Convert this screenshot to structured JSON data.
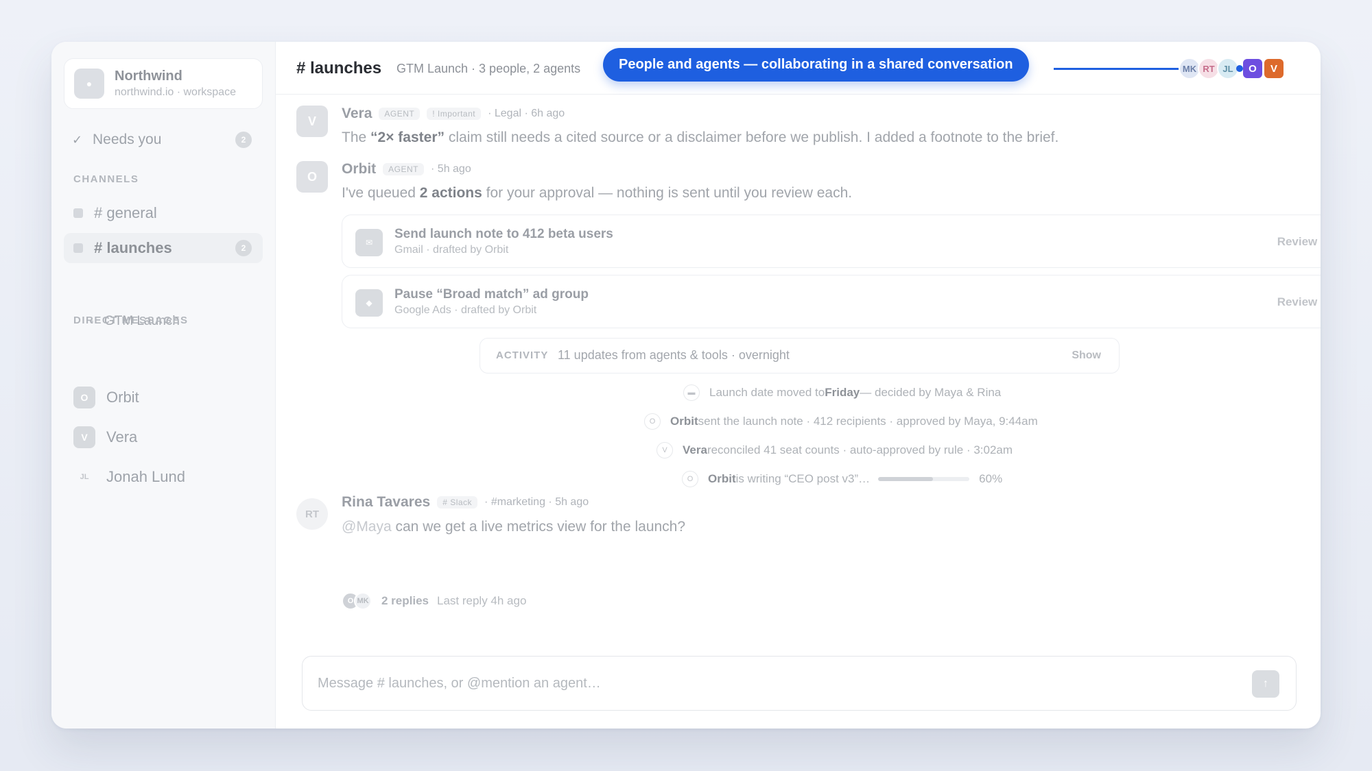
{
  "workspace": {
    "name": "Northwind",
    "subtitle": "northwind.io · workspace",
    "logo_icon": "circle-dot-icon"
  },
  "sidebar": {
    "needs_you": {
      "label": "Needs you",
      "count": "2",
      "icon": "check-icon"
    },
    "channels_heading": "CHANNELS",
    "channels": [
      {
        "label": "# general",
        "active": false,
        "count": ""
      },
      {
        "label": "# launches",
        "active": true,
        "count": "2"
      }
    ],
    "subchannel": "GTM Launch",
    "dm_heading": "DIRECT MESSAGES",
    "dms": [
      {
        "initials": "O",
        "label": "Orbit"
      },
      {
        "initials": "V",
        "label": "Vera"
      },
      {
        "initials": "JL",
        "label": "Jonah Lund"
      }
    ]
  },
  "header": {
    "channel": "# launches",
    "meta": "GTM Launch · 3 people, 2 agents",
    "callout": "People and agents — collaborating in a shared conversation",
    "participants": [
      {
        "initials": "MK",
        "color": "#dfe6f4",
        "text": "#6b7fa8"
      },
      {
        "initials": "RT",
        "color": "#f6dfe6",
        "text": "#c56c8a"
      },
      {
        "initials": "JL",
        "color": "#d8ebf3",
        "text": "#5e8fa6"
      },
      {
        "initials": "O",
        "color": "#6d4ee0",
        "text": "#ffffff"
      },
      {
        "initials": "V",
        "color": "#dd6a2c",
        "text": "#ffffff"
      }
    ],
    "accent": "#1e5fe0"
  },
  "messages": {
    "vera": {
      "avatar": "V",
      "name": "Vera",
      "tag1": "AGENT",
      "tag2": "! Important",
      "meta": "· Legal · 6h ago",
      "body_pre": "The ",
      "body_bold": "“2× faster”",
      "body_post": " claim still needs a cited source or a disclaimer before we publish. I added a footnote to the brief."
    },
    "orbit": {
      "avatar": "O",
      "name": "Orbit",
      "tag1": "AGENT",
      "meta": "· 5h ago",
      "body_pre": "I've queued ",
      "body_bold": "2 actions",
      "body_post": " for your approval — nothing is sent until you review each."
    },
    "rina": {
      "avatar": "RT",
      "name": "Rina Tavares",
      "tag1": "# Slack",
      "meta": "· #marketing · 5h ago",
      "mention": "@Maya",
      "body_post": " can we get a live metrics view for the launch?",
      "replies": "2 replies",
      "last_reply": "Last reply 4h ago",
      "reply_avatars": [
        "O",
        "MK"
      ]
    }
  },
  "actions": [
    {
      "icon": "✉",
      "title": "Send launch note to 412 beta users",
      "sub": "Gmail · drafted by Orbit",
      "cta": "Review →"
    },
    {
      "icon": "◆",
      "title": "Pause “Broad match” ad group",
      "sub": "Google Ads · drafted by Orbit",
      "cta": "Review →"
    }
  ],
  "activity": {
    "label": "ACTIVITY",
    "text": "11 updates from agents & tools · overnight",
    "show": "Show"
  },
  "events": [
    {
      "icon": "calendar-icon",
      "pre": "Launch date moved to ",
      "bold": "Friday",
      "post": " — decided by Maya & Rina"
    },
    {
      "icon": "O",
      "bold_first": "Orbit",
      "post": " sent the launch note · 412 recipients · approved by Maya, 9:44am"
    },
    {
      "icon": "V",
      "bold_first": "Vera",
      "post": " reconciled 41 seat counts · auto-approved by rule · 3:02am"
    },
    {
      "icon": "O",
      "bold_first": "Orbit",
      "post": " is writing “CEO post v3”…",
      "progress": 0.6,
      "progress_label": "60%"
    }
  ],
  "composer": {
    "placeholder": "Message # launches, or @mention an agent…",
    "send_icon": "arrow-up-icon"
  }
}
